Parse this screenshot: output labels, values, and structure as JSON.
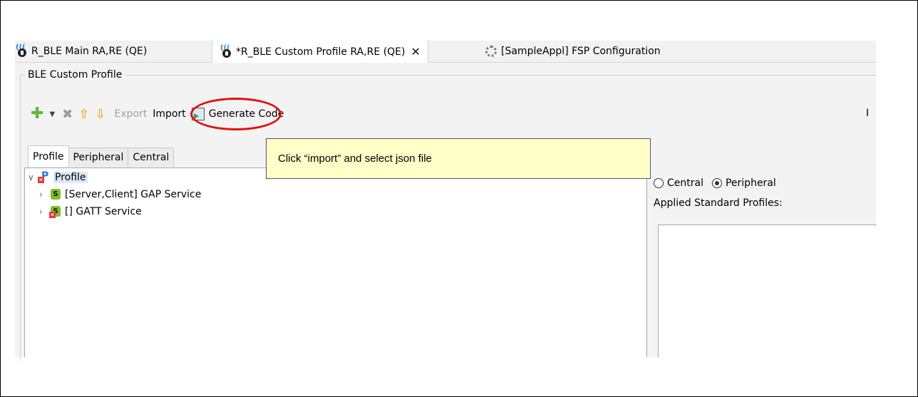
{
  "tabs": [
    {
      "label": "R_BLE Main RA,RE (QE)",
      "active": false
    },
    {
      "label": "*R_BLE Custom Profile RA,RE (QE)",
      "active": true,
      "closable": true
    },
    {
      "label": "[SampleAppl] FSP Configuration",
      "active": false
    }
  ],
  "group": {
    "title": "BLE Custom Profile"
  },
  "toolbar": {
    "add_icon": "plus-icon",
    "export_label": "Export",
    "import_label": "Import",
    "generate_label": "Generate Code",
    "right_stub": "I"
  },
  "subtabs": [
    "Profile",
    "Peripheral",
    "Central"
  ],
  "tree": {
    "root": "Profile",
    "items": [
      "[Server,Client] GAP Service",
      "[] GATT Service"
    ]
  },
  "right_panel": {
    "radio_central": "Central",
    "radio_peripheral": "Peripheral",
    "selected_role": "Peripheral",
    "applied_label": "Applied Standard Profiles:"
  },
  "annotation": {
    "callout_text": "Click “import” and select json file",
    "highlight_color": "#e01010",
    "callout_bg": "#ffffc8"
  }
}
